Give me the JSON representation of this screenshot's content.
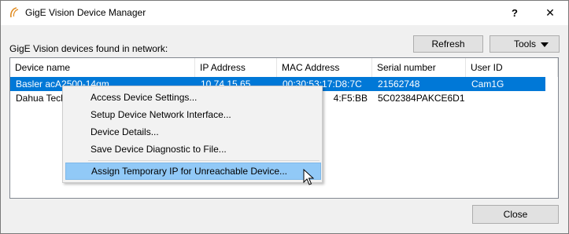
{
  "window": {
    "title": "GigE Vision Device Manager",
    "help_label": "?",
    "close_label": "✕"
  },
  "found_label": "GigE Vision devices found in network:",
  "toolbar": {
    "refresh_label": "Refresh",
    "tools_label": "Tools"
  },
  "table": {
    "columns": [
      "Device name",
      "IP Address",
      "MAC Address",
      "Serial number",
      "User ID"
    ],
    "rows": [
      {
        "device": "Basler acA2500-14gm",
        "ip": "10.74.15.65",
        "mac": "00:30:53:17:D8:7C",
        "serial": "21562748",
        "user": "Cam1G",
        "selected": true
      },
      {
        "device": "Dahua Tech",
        "ip": "",
        "mac": "4:F5:BB",
        "serial": "5C02384PAKCE6D1",
        "user": "",
        "selected": false
      }
    ]
  },
  "context_menu": {
    "items": [
      "Access Device Settings...",
      "Setup Device Network Interface...",
      "Device Details...",
      "Save Device Diagnostic to File...",
      "Assign Temporary IP for Unreachable Device..."
    ]
  },
  "footer": {
    "close_label": "Close"
  },
  "colors": {
    "selection": "#0078d7",
    "menu_highlight": "#91c9f7"
  }
}
